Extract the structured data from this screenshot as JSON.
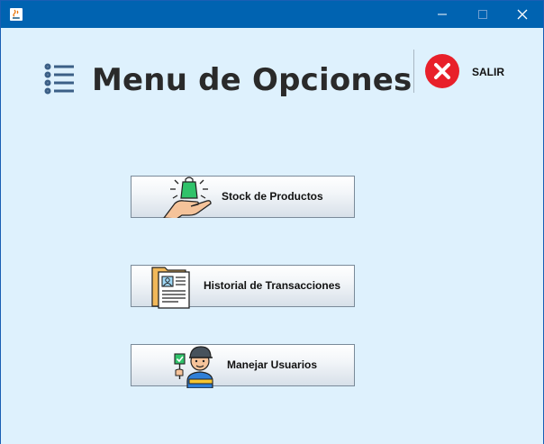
{
  "window": {
    "title": "",
    "controls": [
      "minimize",
      "maximize",
      "close"
    ]
  },
  "header": {
    "title": "Menu de Opciones",
    "icon": "list-menu-icon"
  },
  "salir": {
    "label": "SALIR",
    "icon": "close-circle-icon",
    "color": "#e8202a"
  },
  "buttons": [
    {
      "label": "Stock de Productos",
      "icon": "hand-shopping-bag-icon"
    },
    {
      "label": "Historial de Transacciones",
      "icon": "document-folder-icon"
    },
    {
      "label": "Manejar Usuarios",
      "icon": "user-check-icon"
    }
  ],
  "colors": {
    "titlebar": "#0063b1",
    "background": "#def1fd",
    "accent": "#e8202a"
  }
}
